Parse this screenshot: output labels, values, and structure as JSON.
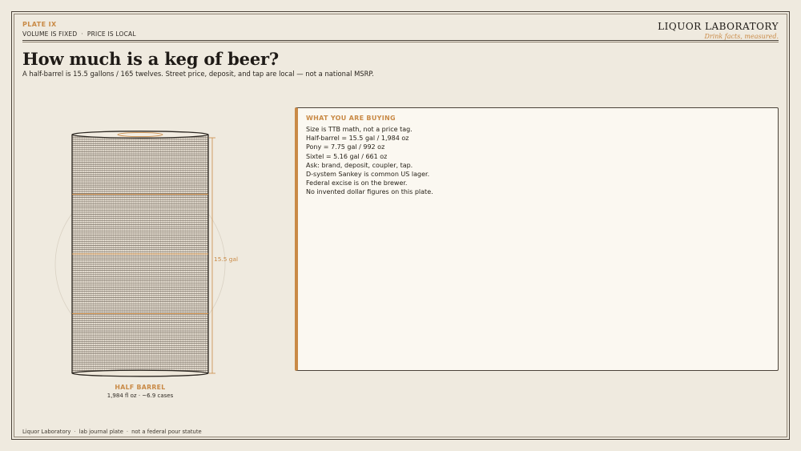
{
  "header": {
    "plate": "PLATE IX",
    "tags": [
      "VOLUME IS FIXED",
      "PRICE IS LOCAL"
    ],
    "separator": "·"
  },
  "brand": {
    "name": "LIQUOR LABORATORY",
    "tagline": "Drink facts, measured."
  },
  "page": {
    "title": "How much is a keg of beer?",
    "lede": "A half-barrel is 15.5 gallons / 165 twelves. Street price, deposit, and tap are local — not a national MSRP."
  },
  "diagram": {
    "volume_label": "15.5 gal",
    "caption_title": "HALF BARREL",
    "caption_detail": "1,984 fl oz  ·  ~6.9 cases",
    "volume_gal": 15.5,
    "quarter_marks": 3
  },
  "panel": {
    "heading": "WHAT YOU ARE BUYING",
    "items": [
      "Size is TTB math, not a price tag.",
      "Half-barrel = 15.5 gal / 1,984 oz",
      "Pony = 7.75 gal / 992 oz",
      "Sixtel = 5.16 gal / 661 oz",
      "Ask: brand, deposit, coupler, tap.",
      "D-system Sankey is common US lager.",
      "Federal excise is on the brewer.",
      "No invented dollar figures on this plate."
    ]
  },
  "footer": {
    "parts": [
      "Liquor Laboratory",
      "lab journal plate",
      "not a federal pour statute"
    ]
  },
  "colors": {
    "accent": "#c98a46",
    "ink": "#2b2620",
    "paper": "#efeadf"
  }
}
